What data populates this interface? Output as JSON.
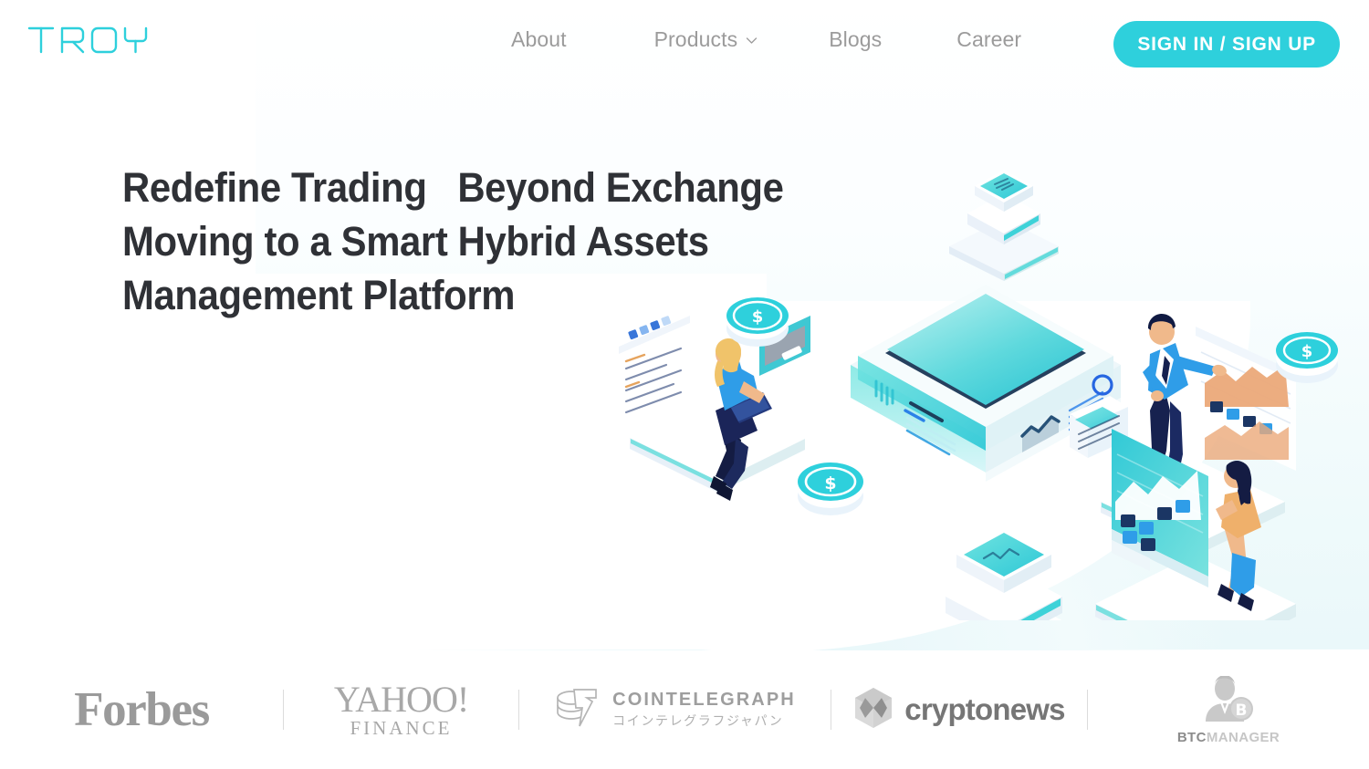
{
  "brand": {
    "name": "TROY",
    "logo_name": "troy-logo",
    "accent_color": "#2ed0dc",
    "text_color": "#2f3136",
    "nav_color": "#9b9b9b"
  },
  "header": {
    "nav": [
      {
        "label": "About",
        "icon": null
      },
      {
        "label": "Products",
        "icon": "chevron-down-icon"
      },
      {
        "label": "Blogs",
        "icon": null
      },
      {
        "label": "Career",
        "icon": null
      }
    ],
    "auth_button": {
      "label": "SIGN IN  /  SIGN UP",
      "sign_in": "SIGN IN",
      "separator": "/",
      "sign_up": "SIGN UP"
    }
  },
  "hero": {
    "headline_lines": [
      "Redefine Trading   Beyond Exchange",
      "Moving to a Smart Hybrid Assets",
      "Management Platform"
    ],
    "illustration_name": "isometric-trading-platform-illustration"
  },
  "partners": {
    "items": [
      {
        "name": "forbes",
        "label": "Forbes"
      },
      {
        "name": "yahoo-finance",
        "label": "YAHOO!",
        "sub_label": "FINANCE"
      },
      {
        "name": "cointelegraph",
        "label": "COINTELEGRAPH",
        "sub_label": "コインテレグラフジャパン"
      },
      {
        "name": "cryptonews",
        "label": "cryptonews"
      },
      {
        "name": "btcmanager",
        "label": "BTC",
        "sub_label": "MANAGER"
      }
    ]
  }
}
